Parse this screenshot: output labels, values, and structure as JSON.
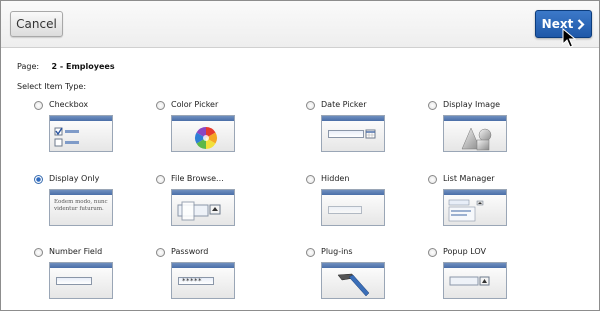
{
  "toolbar": {
    "cancel_label": "Cancel",
    "next_label": "Next"
  },
  "page": {
    "label": "Page:",
    "value": "2 - Employees"
  },
  "select_label": "Select Item Type:",
  "items": [
    {
      "label": "Checkbox",
      "icon": "checkbox-thumbnail-icon",
      "selected": false
    },
    {
      "label": "Color Picker",
      "icon": "color-wheel-icon",
      "selected": false
    },
    {
      "label": "Date Picker",
      "icon": "calendar-icon",
      "selected": false
    },
    {
      "label": "Display Image",
      "icon": "image-shapes-icon",
      "selected": false
    },
    {
      "label": "Display Only",
      "icon": "text-preview-icon",
      "selected": true,
      "preview_text": "Eodem modo, nunc videntur futurum."
    },
    {
      "label": "File Browse...",
      "icon": "file-browse-icon",
      "selected": false
    },
    {
      "label": "Hidden",
      "icon": "hidden-field-icon",
      "selected": false
    },
    {
      "label": "List Manager",
      "icon": "list-manager-icon",
      "selected": false
    },
    {
      "label": "Number Field",
      "icon": "number-field-icon",
      "selected": false
    },
    {
      "label": "Password",
      "icon": "password-field-icon",
      "selected": false,
      "masked": "*****"
    },
    {
      "label": "Plug-ins",
      "icon": "hammer-icon",
      "selected": false
    },
    {
      "label": "Popup LOV",
      "icon": "popup-lov-icon",
      "selected": false
    }
  ],
  "colors": {
    "primary_button": "#2a64b4",
    "selected_radio": "#2f6bc0"
  }
}
